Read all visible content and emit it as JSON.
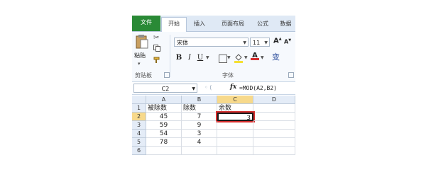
{
  "tabs": [
    "文件",
    "开始",
    "插入",
    "页面布局",
    "公式",
    "数据"
  ],
  "clipboard": {
    "paste_label": "粘贴",
    "group_label": "剪贴板"
  },
  "font": {
    "name": "宋体",
    "size": "11",
    "group_label": "字体",
    "grow": "A",
    "shrink": "A",
    "bold": "B",
    "italic": "I",
    "underline": "U",
    "color_letter": "A",
    "phonetic": "变"
  },
  "colors": {
    "file_tab": "#2a8a36",
    "selection": "#d52d2d",
    "active_header": "#f7d98b",
    "font_color": "#d52d2d",
    "fill_color": "#f5e033"
  },
  "formula_bar": {
    "name_box": "C2",
    "fx": "fx",
    "formula": "=MOD(A2,B2)"
  },
  "columns": [
    "A",
    "B",
    "C",
    "D"
  ],
  "rows": [
    "1",
    "2",
    "3",
    "4",
    "5",
    "6"
  ],
  "cells": [
    [
      "被除数",
      "除数",
      "余数",
      ""
    ],
    [
      "45",
      "7",
      "3",
      ""
    ],
    [
      "59",
      "9",
      "",
      ""
    ],
    [
      "54",
      "3",
      "",
      ""
    ],
    [
      "78",
      "4",
      "",
      ""
    ],
    [
      "",
      "",
      "",
      ""
    ]
  ],
  "selected_cell": "C2"
}
